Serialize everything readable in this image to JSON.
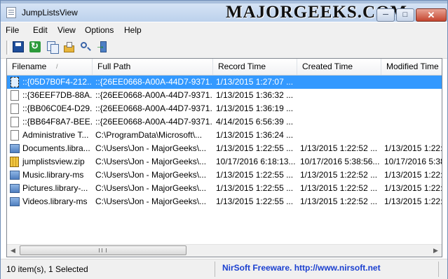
{
  "window": {
    "title": "JumpListsView",
    "watermark": "MAJORGEEKS.COM",
    "controls": {
      "minimize": "─",
      "maximize": "□",
      "close": "✕"
    }
  },
  "menu": {
    "items": [
      "File",
      "Edit",
      "View",
      "Options",
      "Help"
    ]
  },
  "toolbar": {
    "icons": [
      "save-icon",
      "refresh-icon",
      "copy-icon",
      "properties-icon",
      "find-icon",
      "exit-icon"
    ]
  },
  "table": {
    "columns": [
      "Filename",
      "Full Path",
      "Record Time",
      "Created Time",
      "Modified Time"
    ],
    "sort_indicator": "/",
    "rows": [
      {
        "icon": "document-icon",
        "cells": [
          "::{05D7B0F4-212...",
          "::{26EE0668-A00A-44D7-9371...",
          "1/13/2015 1:27:07 ...",
          "",
          ""
        ]
      },
      {
        "icon": "document-icon",
        "cells": [
          "::{36EEF7DB-88A...",
          "::{26EE0668-A00A-44D7-9371...",
          "1/13/2015 1:36:32 ...",
          "",
          ""
        ]
      },
      {
        "icon": "document-icon",
        "cells": [
          "::{BB06C0E4-D29...",
          "::{26EE0668-A00A-44D7-9371...",
          "1/13/2015 1:36:19 ...",
          "",
          ""
        ]
      },
      {
        "icon": "document-icon",
        "cells": [
          "::{BB64F8A7-BEE...",
          "::{26EE0668-A00A-44D7-9371...",
          "4/14/2015 6:56:39 ...",
          "",
          ""
        ]
      },
      {
        "icon": "document-icon",
        "cells": [
          "Administrative T...",
          "C:\\ProgramData\\Microsoft\\...",
          "1/13/2015 1:36:24 ...",
          "",
          ""
        ]
      },
      {
        "icon": "library-icon",
        "cells": [
          "Documents.libra...",
          "C:\\Users\\Jon - MajorGeeks\\...",
          "1/13/2015 1:22:55 ...",
          "1/13/2015 1:22:52 ...",
          "1/13/2015 1:22:5"
        ]
      },
      {
        "icon": "zip-icon",
        "cells": [
          "jumplistsview.zip",
          "C:\\Users\\Jon - MajorGeeks\\...",
          "10/17/2016 6:18:13...",
          "10/17/2016 5:38:56...",
          "10/17/2016 5:38"
        ]
      },
      {
        "icon": "library-icon",
        "cells": [
          "Music.library-ms",
          "C:\\Users\\Jon - MajorGeeks\\...",
          "1/13/2015 1:22:55 ...",
          "1/13/2015 1:22:52 ...",
          "1/13/2015 1:22:5"
        ]
      },
      {
        "icon": "library-icon",
        "cells": [
          "Pictures.library-...",
          "C:\\Users\\Jon - MajorGeeks\\...",
          "1/13/2015 1:22:55 ...",
          "1/13/2015 1:22:52 ...",
          "1/13/2015 1:22:5"
        ]
      },
      {
        "icon": "library-icon",
        "cells": [
          "Videos.library-ms",
          "C:\\Users\\Jon - MajorGeeks\\...",
          "1/13/2015 1:22:55 ...",
          "1/13/2015 1:22:52 ...",
          "1/13/2015 1:22:5"
        ]
      }
    ]
  },
  "scrollbar": {
    "left_arrow": "◀",
    "right_arrow": "▶"
  },
  "status": {
    "count": "10 item(s), 1 Selected",
    "link": "NirSoft Freeware.  http://www.nirsoft.net"
  }
}
